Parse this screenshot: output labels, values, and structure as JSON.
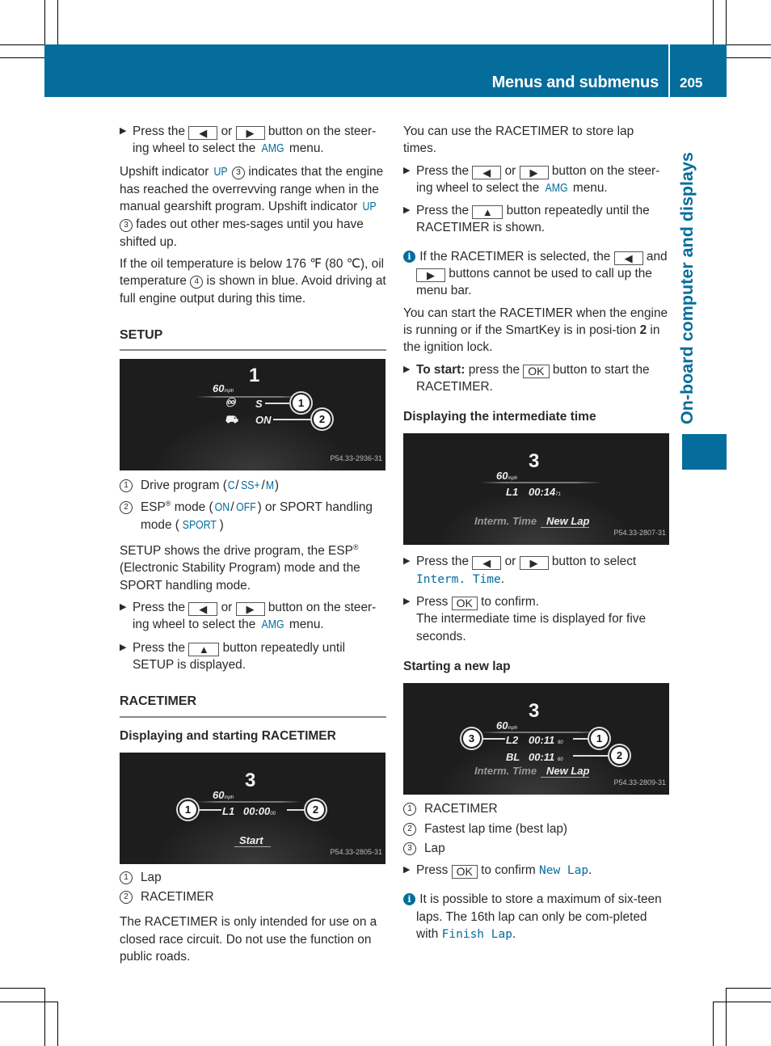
{
  "header": {
    "title": "Menus and submenus",
    "page_number": "205",
    "side_tab": "On-board computer and displays",
    "brand_color": "#046d9c"
  },
  "left_column": {
    "step_amg": {
      "prefix": "Press the",
      "key_left": "◀",
      "or": "or",
      "key_right": "▶",
      "suffix1": "button on the steer-ing wheel to select the",
      "menu": "AMG",
      "suffix2": "menu."
    },
    "upshift": {
      "p1a": "Upshift indicator",
      "up": "UP",
      "num": "3",
      "p1b": "indicates that the engine has reached the overrevving range when in the manual gearshift program. Upshift indicator",
      "p1c": "fades out other mes-sages until you have shifted up."
    },
    "oil": {
      "a": "If the oil temperature is below 176 ℉ (80 ℃), oil temperature",
      "num": "4",
      "b": "is shown in blue. Avoid driving at full engine output during this time."
    },
    "setup": {
      "heading": "SETUP",
      "display": {
        "speed": "60",
        "unit": "mph",
        "gear": "1",
        "drive_program": "S",
        "esp_mode": "ON",
        "ref": "P54.33-2936-31",
        "callouts": [
          "1",
          "2"
        ]
      },
      "legend": [
        {
          "num": "1",
          "text_a": "Drive program (",
          "v1": "C",
          "v2": "SS+",
          "v3": "M",
          "text_b": ")"
        },
        {
          "num": "2",
          "text_a": "ESP",
          "reg": "®",
          "text_b": " mode (",
          "v1": "ON",
          "v2": "OFF",
          "text_c": ") or SPORT handling mode (",
          "v3": "SPORT",
          "text_d": ")"
        }
      ],
      "desc_a": "SETUP shows the drive program, the ESP",
      "desc_reg": "®",
      "desc_b": "(Electronic Stability Program) mode and the SPORT handling mode.",
      "step_amg": {
        "prefix": "Press the",
        "key_left": "◀",
        "or": "or",
        "key_right": "▶",
        "suffix1": "button on the steer-ing wheel to select the",
        "menu": "AMG",
        "suffix2": "menu."
      },
      "step_up": {
        "prefix": "Press the",
        "key": "▲",
        "suffix": "button repeatedly until SETUP is displayed."
      }
    },
    "racetimer": {
      "heading": "RACETIMER",
      "subheading": "Displaying and starting RACETIMER",
      "display": {
        "speed": "60",
        "unit": "mph",
        "gear": "3",
        "lap": "L1",
        "time": "00:00",
        "hundredths": "00",
        "action": "Start",
        "ref": "P54.33-2805-31",
        "callouts": [
          "1",
          "2"
        ]
      },
      "legend": [
        {
          "num": "1",
          "text": "Lap"
        },
        {
          "num": "2",
          "text": "RACETIMER"
        }
      ],
      "warning": "The RACETIMER is only intended for use on a closed race circuit. Do not use the function on public roads."
    }
  },
  "right_column": {
    "intro": "You can use the RACETIMER to store lap times.",
    "step_amg": {
      "prefix": "Press the",
      "key_left": "◀",
      "or": "or",
      "key_right": "▶",
      "suffix1": "button on the steer-ing wheel to select the",
      "menu": "AMG",
      "suffix2": "menu."
    },
    "step_up": {
      "prefix": "Press the",
      "key": "▲",
      "suffix": "button repeatedly until the RACETIMER is shown."
    },
    "info1": {
      "a": "If the RACETIMER is selected, the",
      "key_left": "◀",
      "and": "and",
      "key_right": "▶",
      "b": "buttons cannot be used to call up the menu bar."
    },
    "start_text": {
      "a": "You can start the RACETIMER when the engine is running or if the SmartKey is in posi-tion",
      "bold": "2",
      "b": "in the ignition lock."
    },
    "step_start": {
      "bold": "To start:",
      "a": "press the",
      "key": "OK",
      "b": "button to start the RACETIMER."
    },
    "intermediate": {
      "heading": "Displaying the intermediate time",
      "display": {
        "speed": "60",
        "unit": "mph",
        "gear": "3",
        "lap": "L1",
        "time": "00:14",
        "hundredths": "71",
        "menu_left": "Interm. Time",
        "menu_right": "New Lap",
        "ref": "P54.33-2807-31"
      },
      "step_select": {
        "prefix": "Press the",
        "key_left": "◀",
        "or": "or",
        "key_right": "▶",
        "suffix": "button to select",
        "item": "Interm. Time",
        "end": "."
      },
      "step_confirm": {
        "prefix": "Press",
        "key": "OK",
        "suffix": "to confirm.",
        "result": "The intermediate time is displayed for five seconds."
      }
    },
    "new_lap": {
      "heading": "Starting a new lap",
      "display": {
        "speed": "60",
        "unit": "mph",
        "gear": "3",
        "lap": "L2",
        "time": "00:11",
        "hundredths": "90",
        "best_label": "BL",
        "best_time": "00:11",
        "best_hundredths": "60",
        "menu_left": "Interm. Time",
        "menu_right": "New Lap",
        "ref": "P54.33-2809-31",
        "callouts": [
          "1",
          "2",
          "3"
        ]
      },
      "legend": [
        {
          "num": "1",
          "text": "RACETIMER"
        },
        {
          "num": "2",
          "text": "Fastest lap time (best lap)"
        },
        {
          "num": "3",
          "text": "Lap"
        }
      ],
      "step_confirm": {
        "prefix": "Press",
        "key": "OK",
        "suffix": "to confirm",
        "item": "New Lap",
        "end": "."
      },
      "info2": {
        "a": "It is possible to store a maximum of six-teen laps. The 16th lap can only be com-pleted with",
        "item": "Finish Lap",
        "end": "."
      }
    }
  }
}
